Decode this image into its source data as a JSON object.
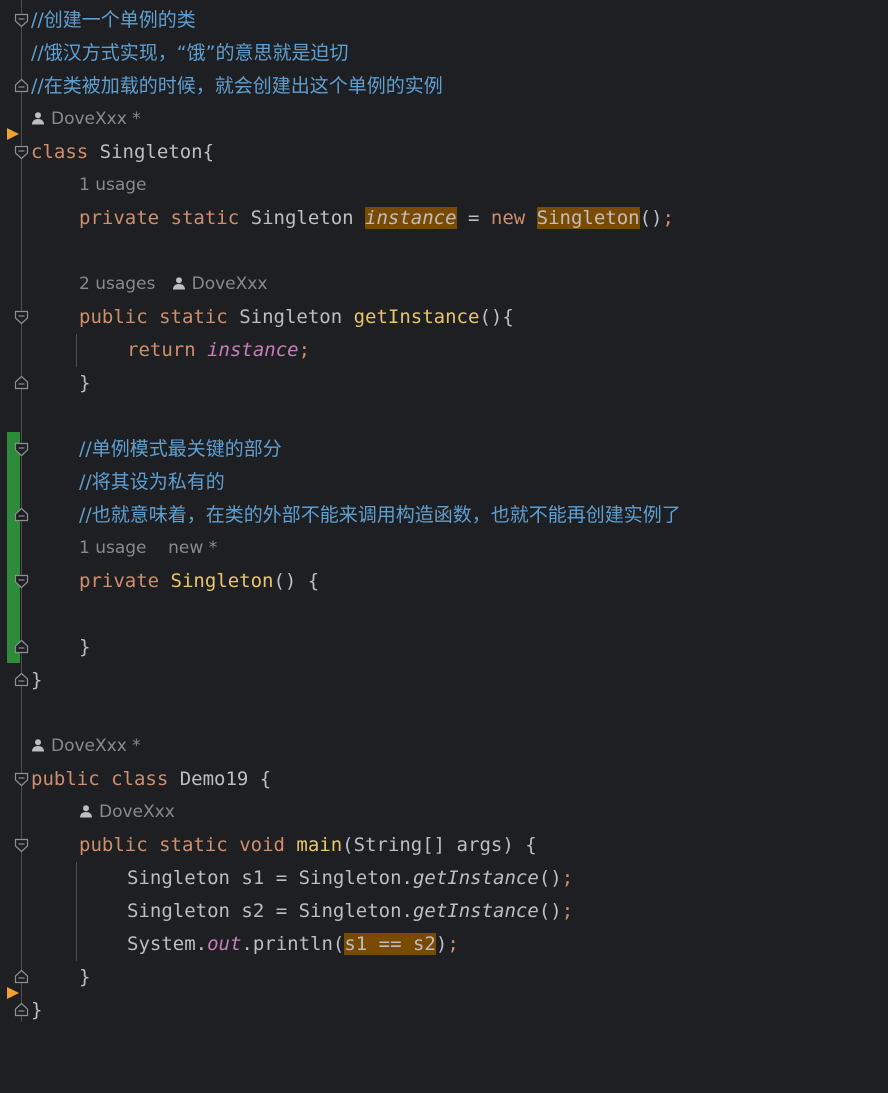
{
  "editor": {
    "lines": {
      "c1": "//创建一个单例的类",
      "c2": "//饿汉方式实现，“饿”的意思就是迫切",
      "c3": "//在类被加载的时候，就会创建出这个单例的实例",
      "author1": "DoveXxx *",
      "class_kw": "class",
      "class_name": " Singleton{",
      "usage1": "1 usage",
      "priv": "private",
      "static": "static",
      "type_singleton": "Singleton",
      "field_instance": "instance",
      "eq": " = ",
      "new_kw": "new",
      "ctor_call": "Singleton",
      "paren_end": "()",
      "semi": ";",
      "usage2": "2 usages",
      "author2": "DoveXxx",
      "pub": "public",
      "get_instance": "getInstance",
      "get_tail": "(){",
      "ret": "return",
      "brace_close": "}",
      "c4": "//单例模式最关键的部分",
      "c5": "//将其设为私有的",
      "c6": "//也就意味着，在类的外部不能来调用构造函数，也就不能再创建实例了",
      "usage3": "1 usage",
      "new_star": "new *",
      "priv_ctor_name": "Singleton",
      "priv_ctor_tail": "() {",
      "author3": "DoveXxx *",
      "class_kw2": "class",
      "demo_name": " Demo19 {",
      "author4": "DoveXxx",
      "void_kw": "void",
      "main_name": "main",
      "main_args": "(String[] args) {",
      "s1_decl": "Singleton s1 = Singleton.",
      "s2_decl": "Singleton s2 = Singleton.",
      "get_call": "getInstance",
      "call_parens": "()",
      "sys": "System.",
      "out": "out",
      "println": ".println(",
      "cmp": "s1 == s2",
      "close_paren": ")"
    }
  },
  "colors": {
    "background": "#1e1f22",
    "keyword": "#cf8e6d",
    "comment": "#5f9fd0",
    "method": "#56a8f5",
    "field": "#c77dbb",
    "highlight": "#7a4a00",
    "change_bar": "#2e8b3a"
  },
  "icons": [
    "fold-open-icon",
    "fold-close-icon",
    "person-icon",
    "breakpoint-arrow-icon"
  ]
}
